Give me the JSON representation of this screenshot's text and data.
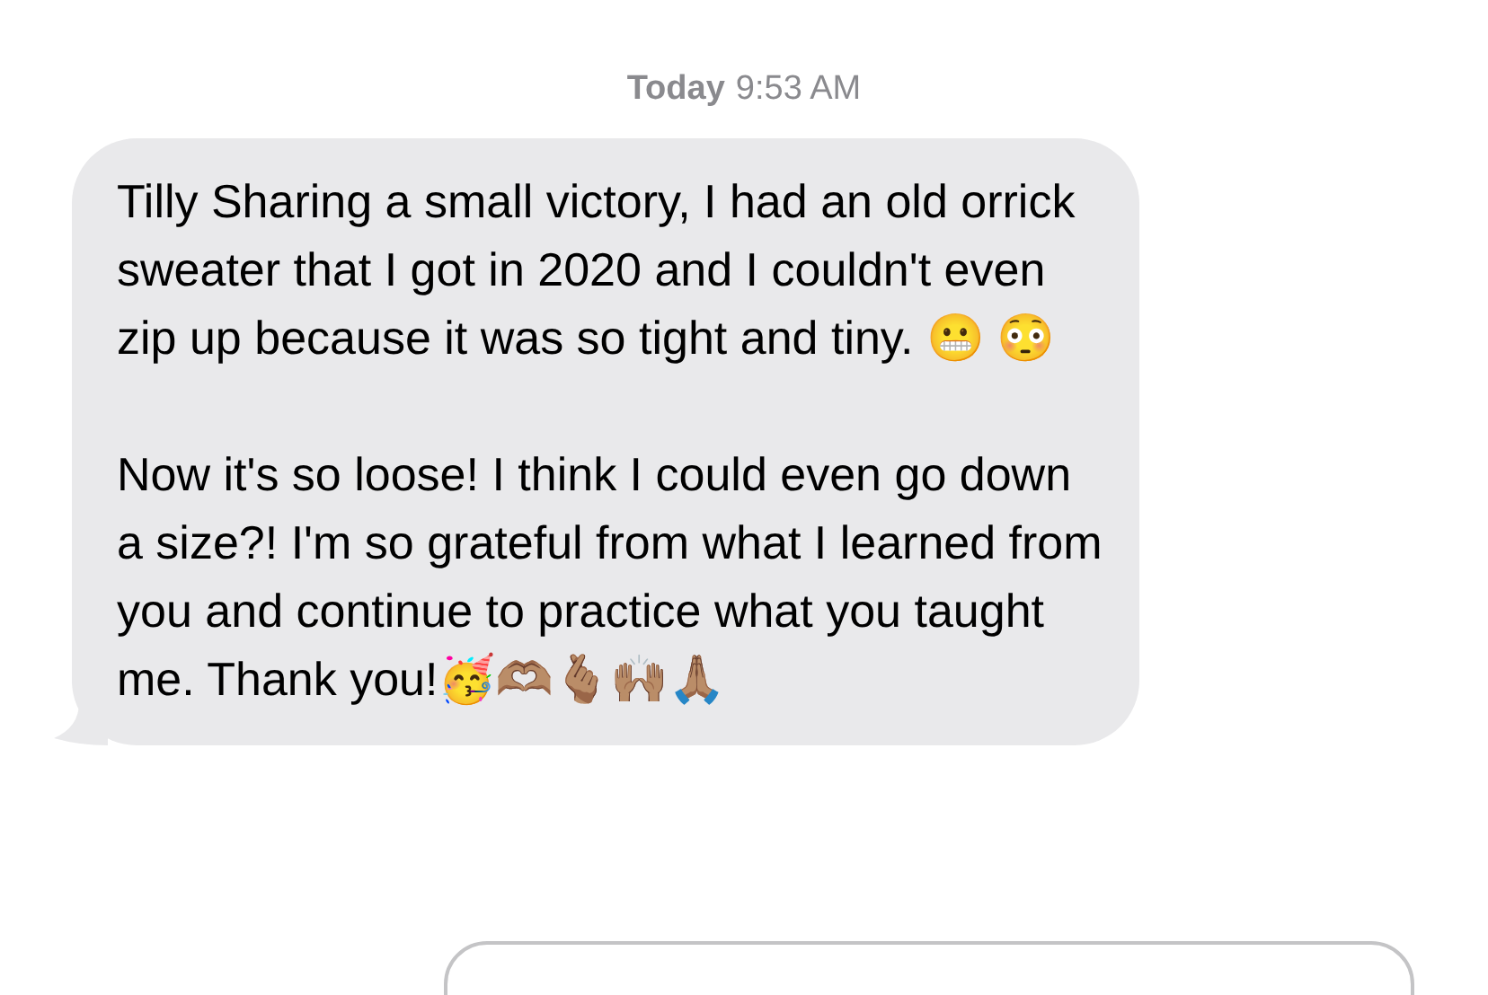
{
  "timestamp": {
    "day": "Today",
    "time": "9:53 AM"
  },
  "message": {
    "paragraphs": [
      "Tilly Sharing a small victory, I had an old orrick sweater that I got in 2020 and I couldn't even zip up because it was so tight and tiny. 😬 😳",
      "Now it's so loose! I think I could even go down a size?! I'm so grateful from what I learned from you and continue to practice what you taught me. Thank you!🥳🫶🏽🫰🏽🙌🏽🙏🏽"
    ]
  }
}
